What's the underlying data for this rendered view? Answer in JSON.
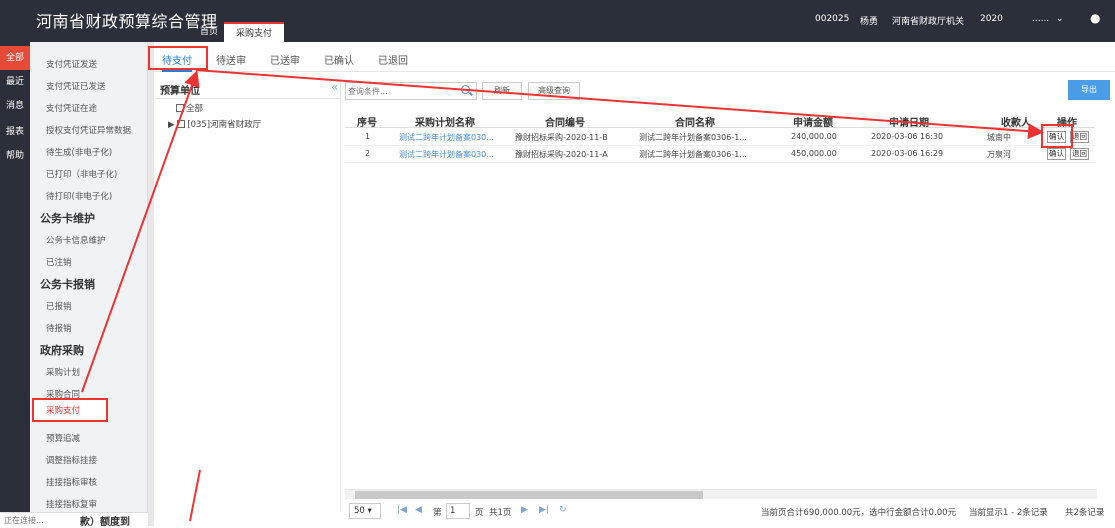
{
  "header": {
    "app_title": "河南省财政预算综合管理",
    "tabs": [
      "首页",
      "采购支付"
    ],
    "code": "002025",
    "user": "杨勇",
    "org": "河南省财政厅机关",
    "year": "2020",
    "dots": "......"
  },
  "rail": [
    "全部",
    "最近",
    "消息",
    "报表",
    "帮助"
  ],
  "menu": {
    "items_a": [
      "支付凭证发送",
      "支付凭证已发送",
      "支付凭证在途",
      "授权支付凭证异常数据",
      "待生成(非电子化)",
      "已打印（非电子化)",
      "待打印(非电子化)"
    ],
    "group_card": "公务卡维护",
    "items_card": [
      "公务卡信息维护",
      "已注销"
    ],
    "group_reimb": "公务卡报销",
    "items_reimb": [
      "已报销",
      "待报销"
    ],
    "group_proc": "政府采购",
    "items_proc": [
      "采购计划",
      "采购合同",
      "采购支付",
      "预算追减",
      "调整指标挂接",
      "挂接指标审核",
      "挂接指标复审"
    ],
    "bottom_partial": "款）额度到"
  },
  "status": "正在连接...",
  "subtabs": [
    "待支付",
    "待送审",
    "已送审",
    "已确认",
    "已退回"
  ],
  "tree": {
    "title": "预算单位",
    "collapse": "«",
    "all": "全部",
    "node": "[035]河南省财政厅"
  },
  "toolbar": {
    "search_placeholder": "查询条件...",
    "refresh": "刷新",
    "advanced": "高级查询",
    "export": "导出"
  },
  "table": {
    "headers": [
      "序号",
      "采购计划名称",
      "合同编号",
      "合同名称",
      "申请金额",
      "申请日期",
      "收款人",
      "操作"
    ],
    "rows": [
      [
        "1",
        "测试二跨年计划备案030...",
        "豫财招标采购-2020-11-B",
        "测试二跨年计划备案0306-1...",
        "240,000.00",
        "2020-03-06 16:30",
        "城南中",
        "确认",
        "退回"
      ],
      [
        "2",
        "测试二跨年计划备案030...",
        "豫财招标采购-2020-11-A",
        "测试二跨年计划备案0306-1...",
        "450,000.00",
        "2020-03-06 16:29",
        "万泉河",
        "确认",
        "退回"
      ]
    ]
  },
  "pager": {
    "page_size": "50",
    "page_prefix": "第",
    "page_no": "1",
    "page_suffix": "页",
    "total_pages": "共1页",
    "summary": "当前页合计690,000.00元，选中行金额合计0.00元",
    "range": "当前显示1 - 2条记录",
    "total": "共2条记录"
  },
  "colors": {
    "accent": "#e33",
    "link": "#4a8fd6",
    "header_bg": "#2b2f3a",
    "export_btn": "#4a9ee8"
  }
}
